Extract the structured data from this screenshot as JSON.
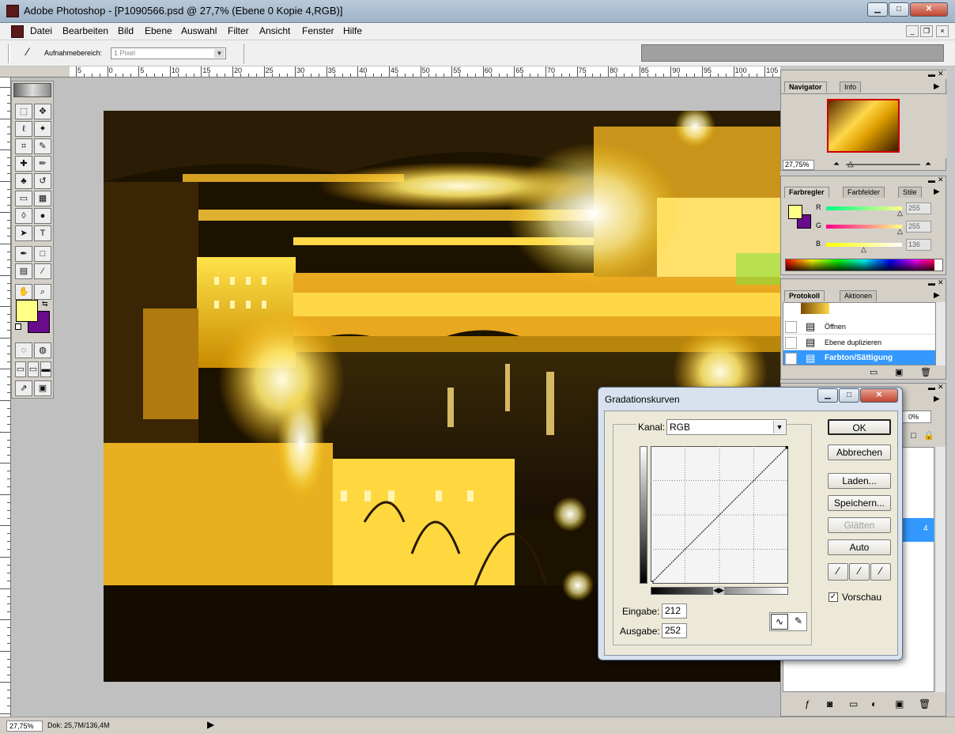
{
  "window": {
    "title": "Adobe Photoshop - [P1090566.psd @ 27,7% (Ebene 0 Kopie 4,RGB)]",
    "controls": {
      "minimize": "▁",
      "maximize": "□",
      "close": "✕"
    }
  },
  "menu": [
    "Datei",
    "Bearbeiten",
    "Bild",
    "Ebene",
    "Auswahl",
    "Filter",
    "Ansicht",
    "Fenster",
    "Hilfe"
  ],
  "mdi_controls": {
    "minimize": "_",
    "restore": "❐",
    "close": "×"
  },
  "options_bar": {
    "label": "Aufnahmebereich:",
    "value": "1 Pixel"
  },
  "ruler_labels": [
    "5",
    "0",
    "5",
    "10",
    "15",
    "20",
    "25",
    "30",
    "35",
    "40",
    "45",
    "50",
    "55",
    "60",
    "65",
    "70",
    "75",
    "80",
    "85",
    "90",
    "95",
    "100",
    "105"
  ],
  "navigator": {
    "tabs": [
      "Navigator",
      "Info"
    ],
    "zoom": "27,75%"
  },
  "color_panel": {
    "tabs": [
      "Farbregler",
      "Farbfelder",
      "Stile"
    ],
    "sliders": [
      {
        "label": "R",
        "value": "255"
      },
      {
        "label": "G",
        "value": "255"
      },
      {
        "label": "B",
        "value": "136"
      }
    ],
    "foreground": "#ffff88",
    "background": "#6a0a8c"
  },
  "history": {
    "tabs": [
      "Protokoll",
      "Aktionen"
    ],
    "items": [
      "Öffnen",
      "Ebene duplizieren",
      "Farbton/Sättigung"
    ]
  },
  "layers_partial": {
    "opacity_fragment": "0%",
    "fragment": "4"
  },
  "status": {
    "zoom": "27,75%",
    "doc": "Dok: 25,7M/136,4M"
  },
  "curves_dialog": {
    "title": "Gradationskurven",
    "channel_label": "Kanal:",
    "channel_value": "RGB",
    "buttons": {
      "ok": "OK",
      "cancel": "Abbrechen",
      "load": "Laden...",
      "save": "Speichern...",
      "smooth": "Glätten",
      "auto": "Auto"
    },
    "input_label": "Eingabe:",
    "input_value": "212",
    "output_label": "Ausgabe:",
    "output_value": "252",
    "preview_label": "Vorschau",
    "curve_points": [
      [
        0,
        0
      ],
      [
        255,
        255
      ]
    ]
  },
  "toolbox": {
    "tools": [
      [
        "marquee-tool",
        "⬚"
      ],
      [
        "move-tool",
        "✥"
      ],
      [
        "lasso-tool",
        "ℓ"
      ],
      [
        "magic-wand-tool",
        "✦"
      ],
      [
        "crop-tool",
        "⌗"
      ],
      [
        "slice-tool",
        "✎"
      ],
      [
        "healing-brush-tool",
        "✚"
      ],
      [
        "brush-tool",
        "✏"
      ],
      [
        "clone-stamp-tool",
        "♣"
      ],
      [
        "history-brush-tool",
        "↺"
      ],
      [
        "eraser-tool",
        "▭"
      ],
      [
        "gradient-tool",
        "▦"
      ],
      [
        "blur-tool",
        "◊"
      ],
      [
        "dodge-tool",
        "●"
      ],
      [
        "path-select-tool",
        "➤"
      ],
      [
        "type-tool",
        "T"
      ],
      [
        "pen-tool",
        "✒"
      ],
      [
        "shape-tool",
        "□"
      ],
      [
        "notes-tool",
        "▤"
      ],
      [
        "eyedropper-tool",
        "⁄"
      ],
      [
        "hand-tool",
        "✋"
      ],
      [
        "zoom-tool",
        "⌕"
      ]
    ]
  }
}
